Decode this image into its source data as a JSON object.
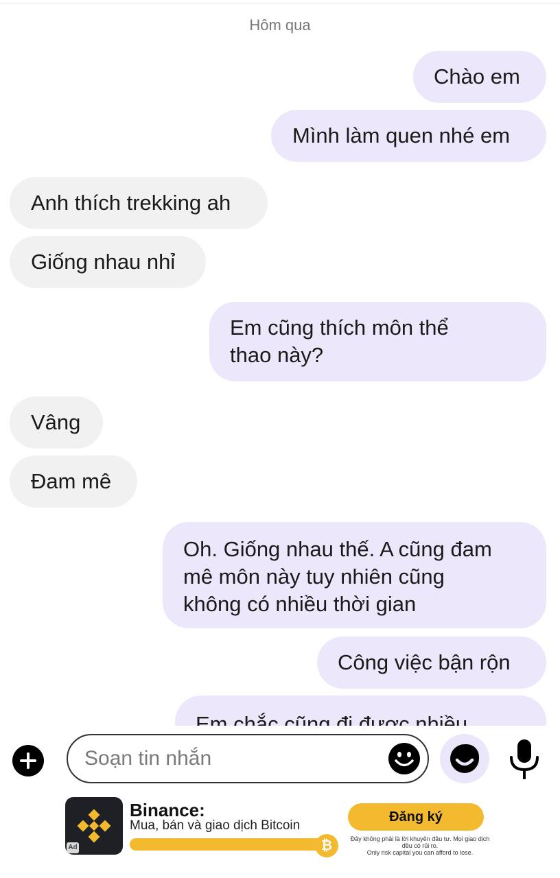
{
  "date_separator": "Hôm qua",
  "messages": [
    {
      "side": "sent",
      "lines": [
        "Chào em"
      ]
    },
    {
      "side": "sent",
      "lines": [
        "Mình làm quen nhé em"
      ]
    },
    {
      "side": "received",
      "lines": [
        "Anh thích trekking ah"
      ]
    },
    {
      "side": "received",
      "lines": [
        "Giống nhau nhỉ"
      ]
    },
    {
      "side": "sent",
      "lines": [
        "Em cũng thích môn thể",
        "thao này?"
      ]
    },
    {
      "side": "received",
      "lines": [
        "Vâng"
      ]
    },
    {
      "side": "received",
      "lines": [
        "Đam mê"
      ]
    },
    {
      "side": "sent",
      "lines": [
        "Oh. Giống nhau thế. A cũng đam",
        "mê môn này tuy nhiên cũng",
        "không có nhiều thời gian"
      ]
    },
    {
      "side": "sent",
      "lines": [
        "Công việc bận rộn"
      ]
    },
    {
      "side": "sent",
      "lines": [
        "Em chắc cũng đi được nhiều"
      ]
    }
  ],
  "composer": {
    "placeholder": "Soạn tin nhắn",
    "add_icon": "plus-circle-icon",
    "emoji_icon": "smiley-face-icon",
    "sticker_icon": "sticker-face-icon",
    "mic_icon": "microphone-icon"
  },
  "ad": {
    "badge": "Ad",
    "title": "Binance:",
    "subtitle": "Mua, bán và giao dịch Bitcoin",
    "cta_label": "Đăng ký",
    "disclaimer_lines": [
      "Đây không phải là lời khuyên đầu tư. Mọi giao dịch",
      "đều có rủi ro.",
      "Only risk capital you can afford to lose."
    ],
    "progress_fraction": 0.95,
    "coin_symbol": "₿",
    "brand_color": "#f3ba2f",
    "logo_icon": "binance-logo-icon"
  },
  "colors": {
    "sent_bubble": "#ede7fb",
    "received_bubble": "#f1f1f1"
  }
}
